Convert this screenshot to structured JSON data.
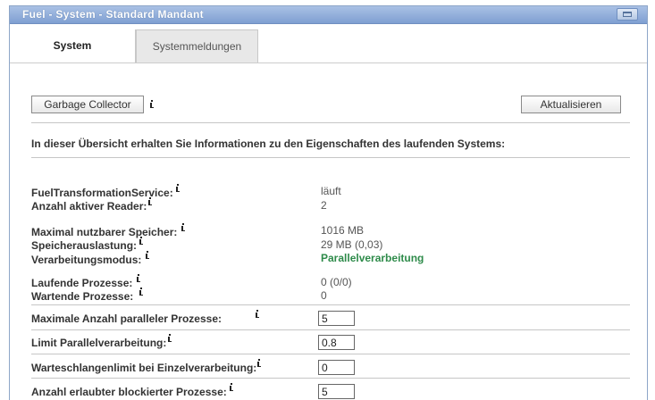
{
  "window": {
    "title": "Fuel - System - Standard Mandant"
  },
  "tabs": [
    {
      "label": "System",
      "active": true
    },
    {
      "label": "Systemmeldungen",
      "active": false
    }
  ],
  "toolbar": {
    "garbage_label": "Garbage Collector",
    "refresh_label": "Aktualisieren"
  },
  "intro": "In dieser Übersicht erhalten Sie Informationen zu den Eigenschaften des laufenden Systems:",
  "status": {
    "service_label": "FuelTransformationService:",
    "service_value": "läuft",
    "reader_label": "Anzahl aktiver Reader:",
    "reader_value": "2",
    "memory_label": "Maximal nutzbarer Speicher:",
    "memory_value": "1016 MB",
    "usage_label": "Speicherauslastung:",
    "usage_value": "29 MB (0,03)",
    "mode_label": "Verarbeitungsmodus:",
    "mode_value": "Parallelverarbeitung",
    "running_label": "Laufende Prozesse:",
    "running_value": "0 (0/0)",
    "waiting_label": "Wartende Prozesse:",
    "waiting_value": "0"
  },
  "settings": {
    "max_parallel_label": "Maximale Anzahl paralleler Prozesse:",
    "max_parallel_value": "5",
    "limit_parallel_label": "Limit Parallelverarbeitung:",
    "limit_parallel_value": "0.8",
    "queue_limit_label": "Warteschlangenlimit bei Einzelverarbeitung:",
    "queue_limit_value": "0",
    "blocked_label": "Anzahl erlaubter blockierter Prozesse:",
    "blocked_value": "5"
  },
  "colors": {
    "titlebar": "#7f9fd2",
    "mode_value": "#2e8b4a"
  }
}
